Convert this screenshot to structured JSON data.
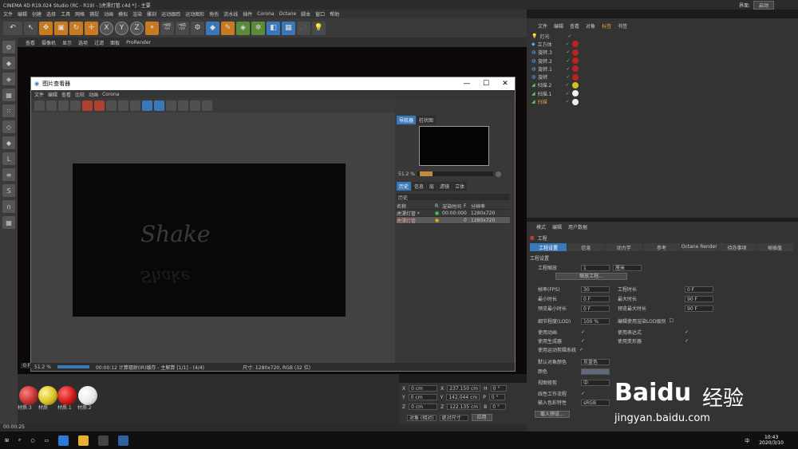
{
  "app_title": "CINEMA 4D R19.024 Studio (RC - R19) - [虎漂灯管.c4d *] - 主要",
  "interface": {
    "label": "界面:",
    "value": "启动"
  },
  "menu": [
    "文件",
    "编辑",
    "创建",
    "选择",
    "工具",
    "网格",
    "捕捉",
    "动画",
    "模拟",
    "渲染",
    "雕刻",
    "运动跟踪",
    "运动图形",
    "角色",
    "流水线",
    "插件",
    "Corona",
    "Octane",
    "脚本",
    "窗口",
    "帮助"
  ],
  "toolbar_axes": [
    "X",
    "Y",
    "Z"
  ],
  "viewport_menu": [
    "查看",
    "摄像机",
    "显示",
    "选项",
    "过滤",
    "面板",
    "ProRender"
  ],
  "picture_viewer": {
    "title": "图片查看器",
    "menu": [
      "文件",
      "编辑",
      "查看",
      "比较",
      "动画",
      "Corona"
    ],
    "right_tabs": [
      "导航器",
      "柱状图"
    ],
    "zoom": "51.2 %",
    "hist_tabs": [
      "历史",
      "信息",
      "层",
      "滤镜",
      "立体"
    ],
    "hist_label": "历史",
    "hist_columns": [
      "名称",
      "R",
      "渲染时间",
      "F",
      "分辨率"
    ],
    "hist_rows": [
      {
        "name": "虎漂灯管 *",
        "time": "00:00:00",
        "frame": "0",
        "res": "1280x720"
      },
      {
        "name": "虎漂灯管",
        "time": "",
        "frame": "0",
        "res": "1280x720"
      }
    ],
    "render_text": "Shake",
    "status_zoom": "51.2 %",
    "status": "00:00:12 计算辐射(IR)缓存 - 主解算 [1/1] - (4/4)",
    "status_size": "尺寸: 1280x720, RGB (32 位)",
    "win_controls": [
      "—",
      "☐",
      "✕"
    ]
  },
  "object_manager": {
    "menu": [
      "文件",
      "编辑",
      "查看",
      "对象",
      "标签",
      "书签"
    ],
    "active_menu": "标签",
    "objects": [
      "灯光",
      "立方体",
      "旋转.3",
      "旋转.2",
      "旋转.1",
      "旋转",
      "扫描.2",
      "扫描.1",
      "扫描"
    ],
    "tag_colors": [
      "",
      "#c02020",
      "#c02020",
      "#c02020",
      "#c02020",
      "#c02020",
      "#d0c020",
      "#f0f0f0",
      "#f0f0f0"
    ]
  },
  "attributes": {
    "menu": [
      "模式",
      "编辑",
      "用户数据"
    ],
    "section": "工程",
    "tabs": [
      "工程设置",
      "信息",
      "动力学",
      "参考",
      "Octane Render",
      "待办事项",
      "帧插值"
    ],
    "group": "工程设置",
    "scale_label": "工程缩放",
    "scale_value": "1",
    "scale_unit": "厘米",
    "scale_button": "缩放工程...",
    "fps_label": "帧率(FPS)",
    "fps": "30",
    "proj_time_label": "工程时长",
    "proj_time": "0 F",
    "min_label": "最小时长",
    "min": "0 F",
    "max_label": "最大时长",
    "max": "90 F",
    "pmin_label": "预览最小时长",
    "pmin": "0 F",
    "pmax_label": "预览最大时长",
    "pmax": "90 F",
    "lod_label": "细节程度(LOD)",
    "lod": "100 %",
    "lod_render": "编辑使用渲染LOD级别",
    "use_anim": "使用动画",
    "use_expr": "使用表达式",
    "use_gen": "使用生成器",
    "use_deform": "使用变形器",
    "use_mo": "使用运动剪辑系统",
    "obj_color_label": "默认对象颜色",
    "obj_color": "灰蓝色",
    "color_label": "颜色",
    "view_label": "视图修剪",
    "view": "中",
    "linear_label": "线性工作流程",
    "input_color_label": "输入色彩特性",
    "input_color": "sRGB",
    "load_btn": "载入预设..."
  },
  "materials": [
    "材质.3",
    "材质",
    "材质.1",
    "材质.2"
  ],
  "material_colors": [
    "#c03030",
    "#d8c020",
    "#d01818",
    "#e8e8e8"
  ],
  "coords": {
    "rows": [
      {
        "a": "X",
        "v1": "0 cm",
        "b": "X",
        "v2": "237.150 cm",
        "c": "H",
        "v3": "0 °"
      },
      {
        "a": "Y",
        "v1": "0 cm",
        "b": "Y",
        "v2": "142.044 cm",
        "c": "P",
        "v3": "0 °"
      },
      {
        "a": "Z",
        "v1": "0 cm",
        "b": "Z",
        "v2": "122.135 cm",
        "c": "B",
        "v3": "0 °"
      }
    ],
    "mode": "对象 (相对)",
    "size_mode": "绝对尺寸",
    "apply": "应用"
  },
  "frame_label": "0 F",
  "timeline_time": "00:00:25",
  "taskbar": {
    "time": "10:43",
    "date": "2020/3/10",
    "lang": "中"
  },
  "watermark": {
    "brand": "Baidu",
    "cn": "经验",
    "url": "jingyan.baidu.com"
  }
}
